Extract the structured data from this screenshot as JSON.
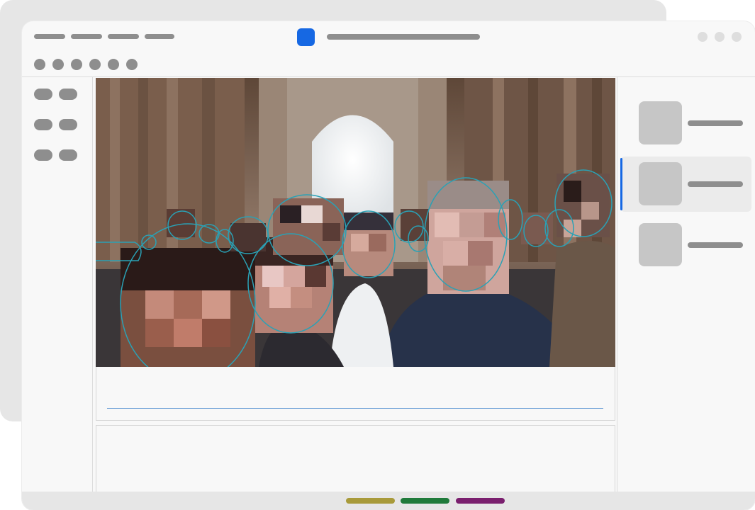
{
  "theme": {
    "accent": "#1668e3",
    "face_outline": "#2aa1b5"
  },
  "titlebar": {
    "menu_placeholders": 4,
    "app_icon": "app-icon",
    "title_placeholder": "title-line",
    "window_controls": [
      "minimize-icon",
      "maximize-icon",
      "close-icon"
    ]
  },
  "toolbar": {
    "tool_buttons": [
      "tool-1-icon",
      "tool-2-icon",
      "tool-3-icon",
      "tool-4-icon",
      "tool-5-icon",
      "tool-6-icon"
    ]
  },
  "left_sidebar": {
    "rows": 3
  },
  "right_panel": {
    "items": [
      {
        "name": "panel-item-1",
        "selected": false
      },
      {
        "name": "panel-item-2",
        "selected": true
      },
      {
        "name": "panel-item-3",
        "selected": false
      }
    ]
  },
  "image": {
    "description_icon": "photo-with-pixelated-faces",
    "faces_detected": 16
  },
  "status_bar": {
    "colors": [
      "#a89a3a",
      "#1f7a3a",
      "#7a1f6e"
    ]
  }
}
